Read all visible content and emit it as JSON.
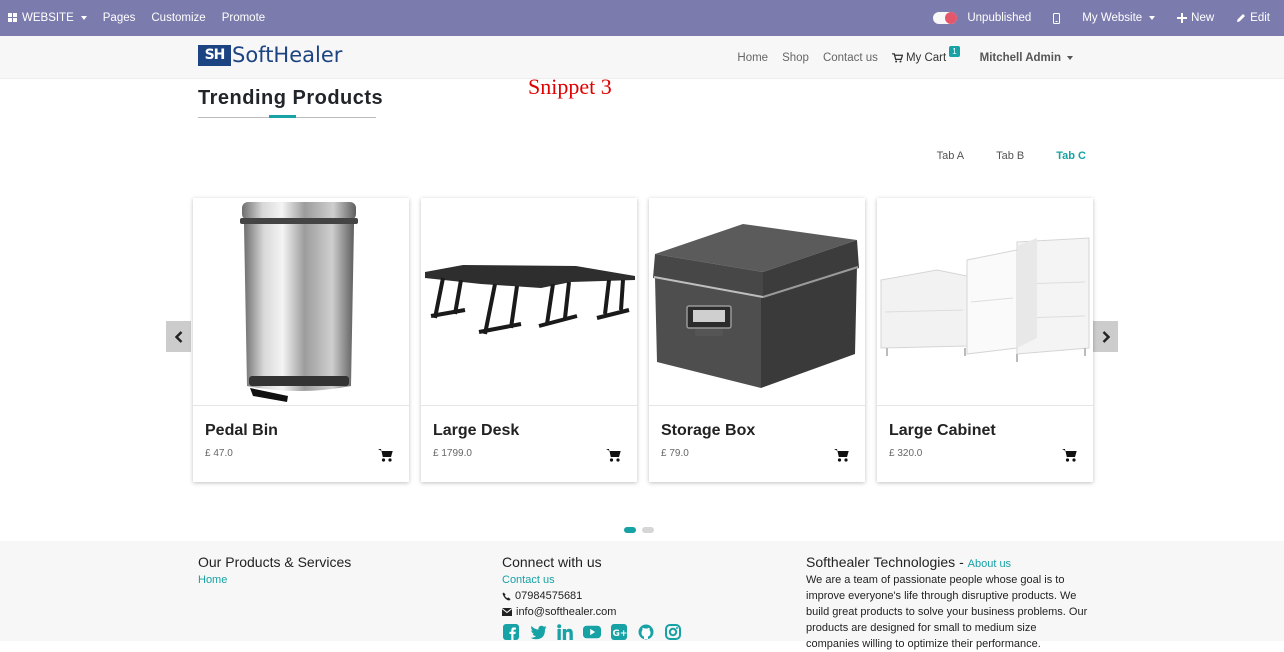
{
  "adminbar": {
    "website_label": "WEBSITE",
    "pages_label": "Pages",
    "customize_label": "Customize",
    "promote_label": "Promote",
    "unpublished_label": "Unpublished",
    "my_website_label": "My Website",
    "new_label": "New",
    "edit_label": "Edit"
  },
  "header": {
    "logo_mark": "SH",
    "logo_text": "SoftHealer",
    "nav": [
      "Home",
      "Shop",
      "Contact us"
    ],
    "cart_label": "My Cart",
    "cart_count": "1",
    "user_label": "Mitchell Admin"
  },
  "section": {
    "title": "Trending Products",
    "snippet_label": "Snippet 3",
    "tabs": [
      "Tab A",
      "Tab B",
      "Tab C"
    ],
    "active_tab": "Tab C"
  },
  "products": [
    {
      "name": "Pedal Bin",
      "price": "£ 47.0"
    },
    {
      "name": "Large Desk",
      "price": "£ 1799.0"
    },
    {
      "name": "Storage Box",
      "price": "£ 79.0"
    },
    {
      "name": "Large Cabinet",
      "price": "£ 320.0"
    }
  ],
  "carousel": {
    "pages": 2,
    "active_page": 1
  },
  "footer": {
    "col1": {
      "title": "Our Products & Services",
      "links": [
        "Home"
      ]
    },
    "col2": {
      "title": "Connect with us",
      "contact_link": "Contact us",
      "phone": "07984575681",
      "email": "info@softhealer.com"
    },
    "col3": {
      "title": "Softhealer Technologies",
      "about_link": "About us",
      "text": "We are a team of passionate people whose goal is to improve everyone's life through disruptive products. We build great products to solve your business problems. Our products are designed for small to medium size companies willing to optimize their performance."
    }
  },
  "colors": {
    "adminbar": "#7c7bad",
    "accent": "#17a2a6",
    "brand": "#1d4482",
    "snippet": "#e00000"
  }
}
